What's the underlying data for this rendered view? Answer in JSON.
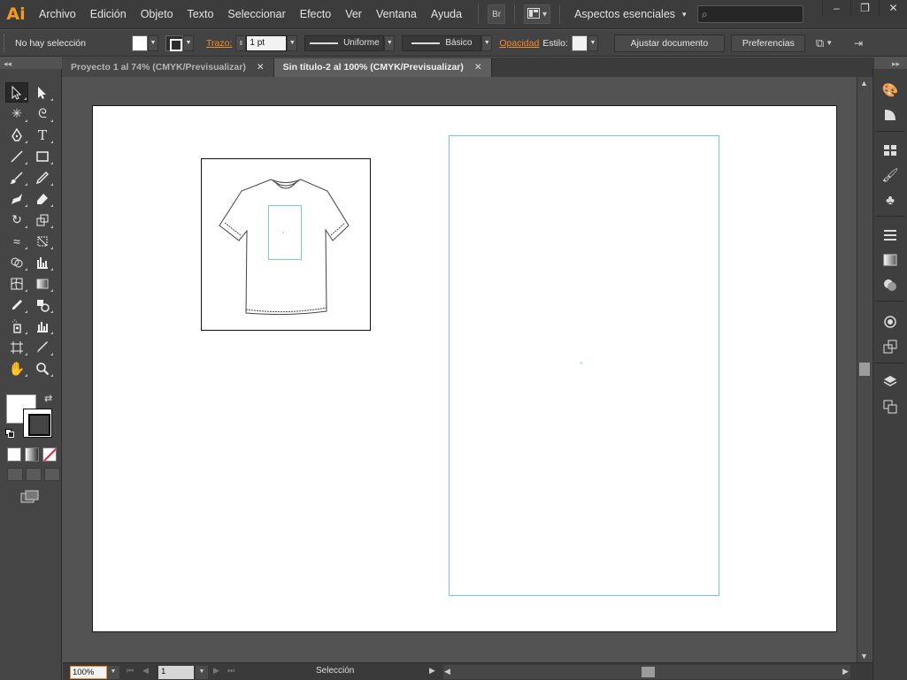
{
  "app": {
    "logo": "Ai"
  },
  "menu": [
    "Archivo",
    "Edición",
    "Objeto",
    "Texto",
    "Seleccionar",
    "Efecto",
    "Ver",
    "Ventana",
    "Ayuda"
  ],
  "menubar": {
    "bridge_label": "Br",
    "workspace": "Aspectos esenciales",
    "search_placeholder": ""
  },
  "window_controls": {
    "minimize": "–",
    "restore": "❐",
    "close": "✕"
  },
  "controlbar": {
    "selection_status": "No hay selección",
    "stroke_label": "Trazo:",
    "stroke_weight": "1 pt",
    "profile": "Uniforme",
    "brush": "Básico",
    "opacity_label": "Opacidad",
    "style_label": "Estilo:",
    "adjust_document": "Ajustar documento",
    "preferences": "Preferencias"
  },
  "tabs": [
    {
      "label": "Proyecto 1 al 74% (CMYK/Previsualizar)",
      "active": false,
      "close": "✕"
    },
    {
      "label": "Sin título-2 al 100% (CMYK/Previsualizar)",
      "active": true,
      "close": "✕"
    }
  ],
  "panels": {
    "collapse_left": "◂◂",
    "collapse_right": "▸▸"
  },
  "statusbar": {
    "zoom": "100%",
    "page": "1",
    "tool_status": "Selección"
  },
  "colors": {
    "accent": "#f08a2c",
    "artboard_guide": "#7cc9d6",
    "ui_dark": "#3c3c3c"
  }
}
